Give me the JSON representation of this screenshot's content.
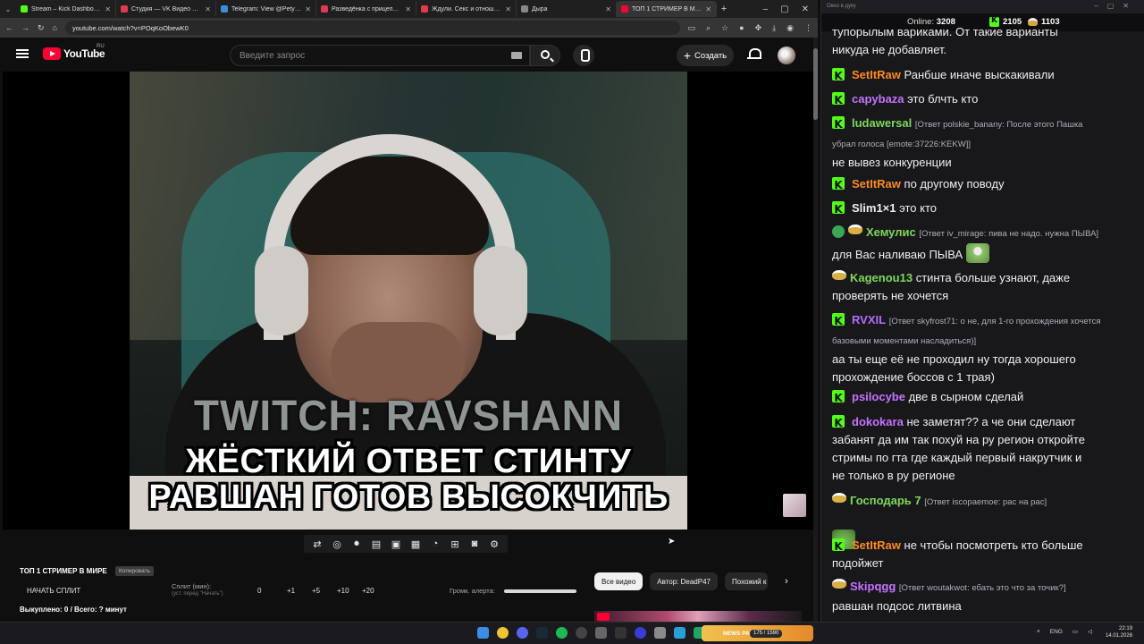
{
  "browser": {
    "tabs": [
      {
        "label": "Stream – Kick Dashboard",
        "color": "#53fc18",
        "active": false
      },
      {
        "label": "Студия — VK Видео Live",
        "color": "#e03a4e",
        "active": false
      },
      {
        "label": "Telegram: View @Petya_per...",
        "color": "#3b8fd9",
        "active": false
      },
      {
        "label": "Разведёнка с прицепом (Р...",
        "color": "#e03a4e",
        "active": false
      },
      {
        "label": "Ждули. Секс и отношение ...",
        "color": "#e03a4e",
        "active": false
      },
      {
        "label": "Дыра",
        "color": "#888888",
        "active": false
      },
      {
        "label": "ТОП 1 СТРИМЕР В МИРЕ",
        "color": "#ff0033",
        "active": true
      }
    ],
    "url": "youtube.com/watch?v=POqKoObewK0"
  },
  "youtube": {
    "logo_text": "YouTube",
    "logo_region": "RU",
    "search_placeholder": "Введите запрос",
    "create_label": "Создать"
  },
  "video": {
    "watermark": "TWITCH: RAVSHANN",
    "caption_line1": "ЖЁСТКИЙ ОТВЕТ СТИНТУ",
    "caption_line2": "РАВШАН ГОТОВ ВЫСОКЧИТЬ"
  },
  "below_video": {
    "title": "ТОП 1 СТРИМЕР В МИРЕ",
    "copy_label": "Копировать",
    "split_button": "НАЧАТЬ СПЛИТ",
    "split_label": "Сплит (мин):",
    "split_hint": "(уст. перед \"Начать\")",
    "split_values": [
      "0",
      "+1",
      "+5",
      "+10",
      "+20"
    ],
    "alert_label": "Громк. алерта:",
    "bought": "Выкуплено: 0 / Всего: ? минут",
    "chips": [
      "Все видео",
      "Автор: DeadP47",
      "Похожий к"
    ]
  },
  "chat": {
    "window_title": "Окно в дуку",
    "online_label": "Online:",
    "online_count": "3208",
    "kick_count": "2105",
    "beer_count": "1103",
    "top_line": "тупорылым вариками. От такие варианты",
    "messages": [
      {
        "cont": "никуда не добавляет."
      },
      {
        "user": "SetItRaw",
        "color": "#ff8a1c",
        "badge": "k",
        "text": "Ранбше иначе выскакивали"
      },
      {
        "user": "capybaza",
        "color": "#c673ff",
        "badge": "k",
        "text": "это блчть кто"
      },
      {
        "user": "ludawersal",
        "color": "#7fd85a",
        "badge": "k",
        "reply": "[Ответ polskie_banany: После этого Пашка",
        "reply2": "убрал голоса [emote:37226:KEKW]]",
        "text": "не вывез конкуренции"
      },
      {
        "user": "SetItRaw",
        "color": "#ff8a1c",
        "badge": "k",
        "text": "по другому поводу"
      },
      {
        "user": "Slim1×1",
        "color": "#efeff1",
        "badge": "k",
        "text": "это кто"
      },
      {
        "user": "Хемулис",
        "color": "#7fd85a",
        "badge": "vb",
        "reply": "[Ответ iv_mirage: пива не надо. нужна ПЫВА]",
        "text": "для Вас наливаю ПЫВА"
      },
      {
        "user": "Kagenou13",
        "color": "#7fd85a",
        "badge": "b",
        "text": "стинта больше узнают, даже",
        "text2": "проверять не хочется"
      },
      {
        "user": "RVXIL",
        "color": "#b66bff",
        "badge": "k",
        "reply": "[Ответ skyfrost71: о не, для 1-го прохождения хочется",
        "reply2": "базовыми моментами насладиться)]",
        "text": "аа ты еще её не проходил ну тогда хорошего",
        "text2": "прохождение боссов с 1 трая)"
      },
      {
        "user": "psilocybe",
        "color": "#c673ff",
        "badge": "k",
        "text": "две в сырном сделай"
      },
      {
        "user": "dokokara",
        "color": "#c673ff",
        "badge": "k",
        "text": "не заметят?? а че они сделают",
        "text2": "забанят да им так похуй на ру регион откройте",
        "text3": "стримы по гта где каждый первый накрутчик и",
        "text4": "не только в ру регионе"
      },
      {
        "user": "Господарь 7",
        "color": "#7fd85a",
        "badge": "b",
        "reply": "[Ответ iscopaemoe: рас на рас]"
      },
      {
        "user": "SetItRaw",
        "color": "#ff8a1c",
        "badge": "k",
        "text": "не чтобы посмотреть кто больше",
        "text2": "подойжет"
      },
      {
        "user": "Skipqgg",
        "color": "#c673ff",
        "badge": "b",
        "reply": "[Ответ woutakwot: ебать это что за точик?]",
        "text": "равшан подсос литвина"
      }
    ]
  },
  "taskbar": {
    "news_label": "NEWS PARTY",
    "news_count": "175 / 1590",
    "lang": "ENG",
    "time": "22:19",
    "date": "14.01.2026"
  }
}
